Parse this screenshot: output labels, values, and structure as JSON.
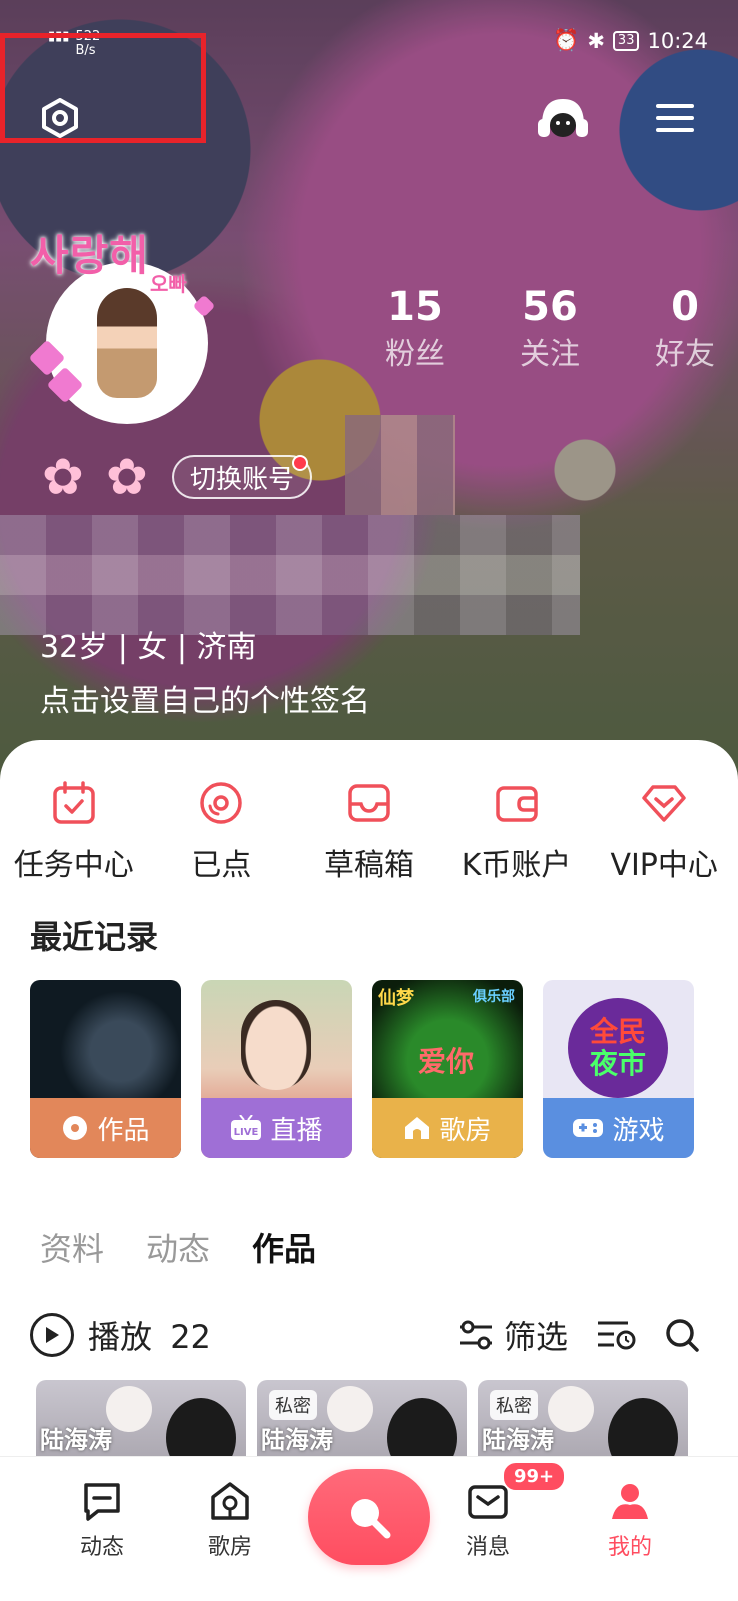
{
  "status_bar": {
    "speed_value": "522",
    "speed_unit": "B/s",
    "battery": "33",
    "time": "10:24"
  },
  "profile": {
    "sticker_text": "사랑해",
    "sticker_sub": "오빠",
    "stats": [
      {
        "value": "15",
        "label": "粉丝"
      },
      {
        "value": "56",
        "label": "关注"
      },
      {
        "value": "0",
        "label": "好友"
      }
    ],
    "switch_account": "切换账号",
    "info": "32岁 | 女 | 济南",
    "signature": "点击设置自己的个性签名"
  },
  "quick_actions": [
    {
      "label": "任务中心",
      "icon": "calendar-check-icon"
    },
    {
      "label": "已点",
      "icon": "disc-icon"
    },
    {
      "label": "草稿箱",
      "icon": "inbox-icon"
    },
    {
      "label": "K币账户",
      "icon": "wallet-icon"
    },
    {
      "label": "VIP中心",
      "icon": "diamond-icon"
    }
  ],
  "recent": {
    "title": "最近记录",
    "cards": [
      {
        "label": "作品",
        "icon": "disc-icon",
        "color": "#e2875a"
      },
      {
        "label": "直播",
        "icon": "live-tv-icon",
        "color": "#9f6fd6"
      },
      {
        "label": "歌房",
        "icon": "house-icon",
        "color": "#e9b24a"
      },
      {
        "label": "游戏",
        "icon": "gamepad-icon",
        "color": "#5a8fe0"
      }
    ],
    "card3_title": "仙梦",
    "card3_sub": "俱乐部",
    "card3_text": "爱你",
    "card4_text_1": "全民",
    "card4_text_2": "夜市"
  },
  "tabs": [
    "资料",
    "动态",
    "作品"
  ],
  "active_tab": "作品",
  "works_toolbar": {
    "play_label": "播放",
    "play_count": "22",
    "filter_label": "筛选"
  },
  "works": [
    {
      "text": "陆海涛",
      "private": ""
    },
    {
      "text": "陆海涛",
      "private": "私密"
    },
    {
      "text": "陆海涛",
      "private": "私密"
    }
  ],
  "bottom_nav": [
    {
      "label": "动态"
    },
    {
      "label": "歌房"
    },
    {
      "label": "消息"
    },
    {
      "label": "我的"
    }
  ],
  "badge": "99+",
  "colors": {
    "accent": "#ff4d60",
    "highlight": "#e8232a"
  }
}
